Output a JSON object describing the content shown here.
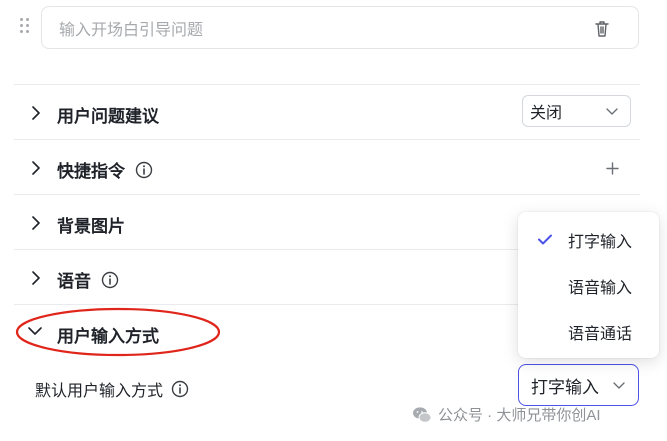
{
  "opener": {
    "placeholder": "输入开场白引导问题"
  },
  "sections": [
    {
      "label": "用户问题建议",
      "control_value": "关闭"
    },
    {
      "label": "快捷指令"
    },
    {
      "label": "背景图片"
    },
    {
      "label": "语音"
    },
    {
      "label": "用户输入方式"
    }
  ],
  "input_mode": {
    "default_label": "默认用户输入方式",
    "selected": "打字输入",
    "options": [
      "打字输入",
      "语音输入",
      "语音通话"
    ]
  },
  "watermark": {
    "text": "公众号 · 大师兄带你创AI"
  },
  "colors": {
    "accent": "#4d53e8",
    "annotation": "#e0251b",
    "divider": "#e9ebee",
    "text": "#1f2329"
  }
}
